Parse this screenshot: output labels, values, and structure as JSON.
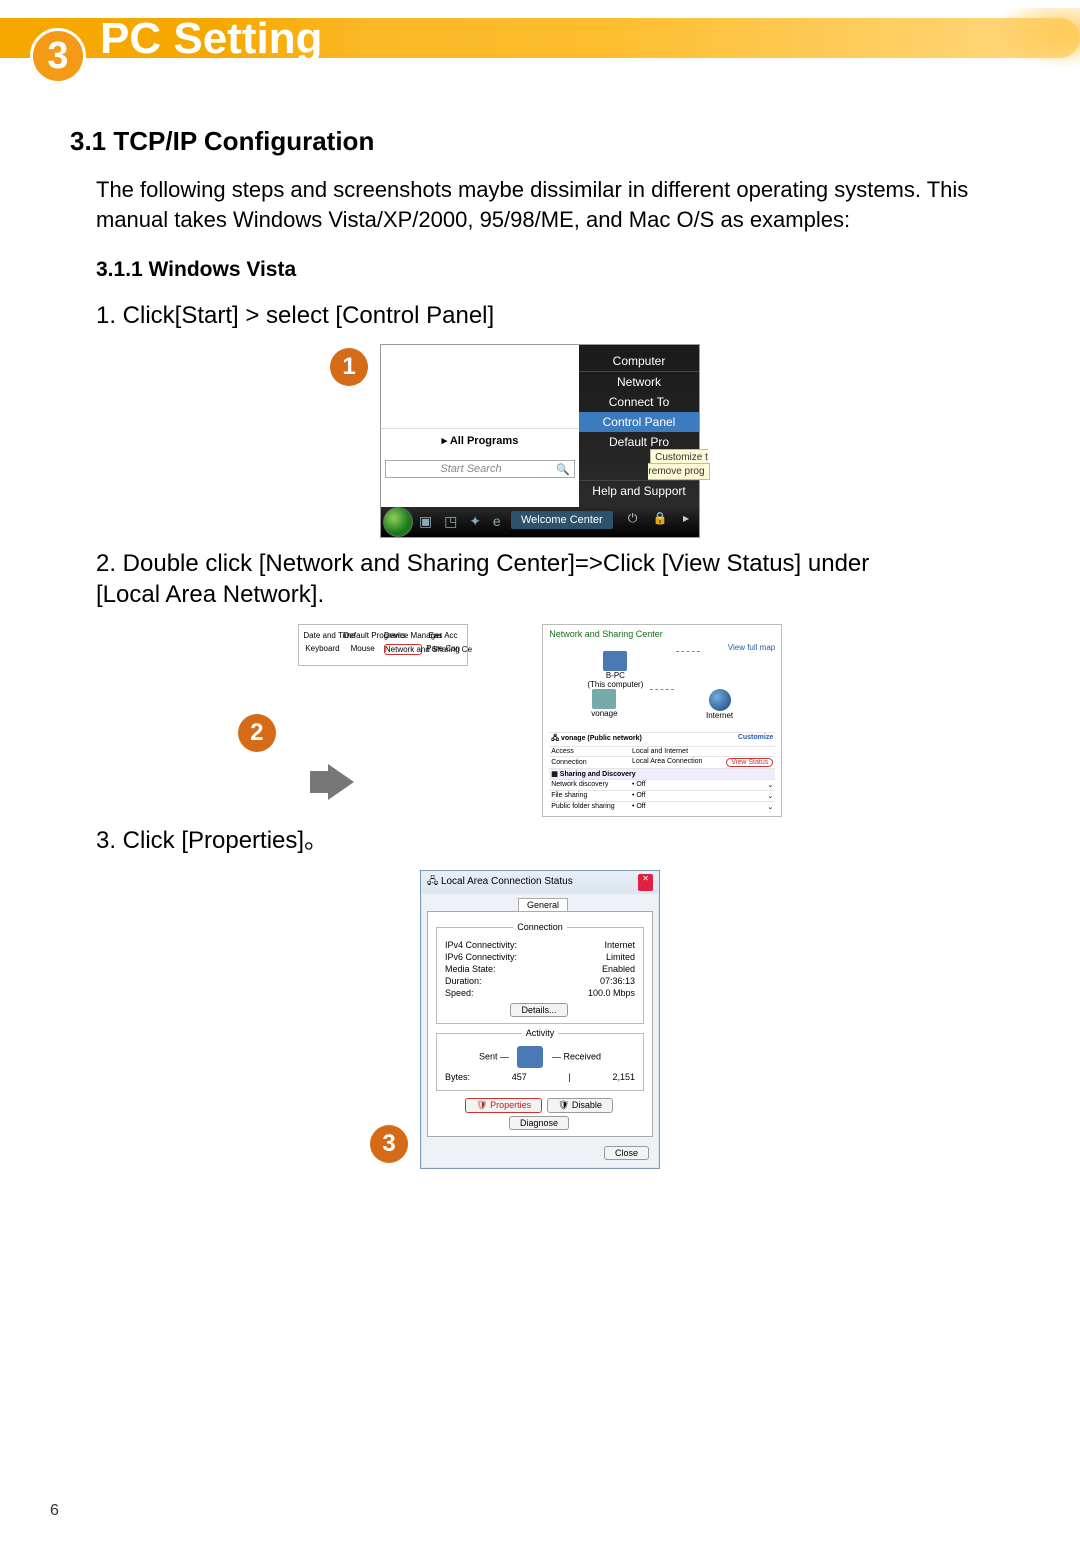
{
  "chapter": {
    "number": "3",
    "title": "PC Setting"
  },
  "section": {
    "heading": "3.1 TCP/IP Configuration"
  },
  "intro": "The following steps and screenshots maybe dissimilar in  different operating systems. This manual takes Windows Vista/XP/2000, 95/98/ME, and Mac O/S as examples:",
  "subsection": {
    "heading": "3.1.1 Windows Vista"
  },
  "steps": {
    "s1": "1. Click[Start] > select [Control Panel]",
    "s2": "2. Double click [Network and Sharing Center]=>Click [View Status] under [Local Area Network].",
    "s3": "3. Click [Properties]。"
  },
  "badges": {
    "b1": "1",
    "b2": "2",
    "b3": "3"
  },
  "fig1": {
    "right_menu": {
      "computer": "Computer",
      "network": "Network",
      "connect": "Connect To",
      "control_panel": "Control Panel",
      "default": "Default Pro",
      "tooltip1": "Customize t",
      "tooltip2": "remove prog",
      "help": "Help and Support"
    },
    "all_programs": "All Programs",
    "search_placeholder": "Start Search",
    "taskbar_tab": "Welcome Center",
    "tray_icons": "⏻  🔒  ▸"
  },
  "fig2": {
    "ctrl_icons": {
      "r1c1": "Date and Time",
      "r1c2": "Default Programs",
      "r1c3": "Device Manager",
      "r1c4": "Eas Acc",
      "r2c1": "Keyboard",
      "r2c2": "Mouse",
      "r2c3": "Network and Sharing Ce",
      "r2c4": "Pare Con"
    },
    "ns_title": "Network and Sharing Center",
    "view_full_map": "View full map",
    "pc_label": "B-PC",
    "pc_sub": "(This computer)",
    "mid_label": "vonage",
    "net_label": "Internet",
    "customize": "Customize",
    "row_net": "vonage (Public network)",
    "row_access_l": "Access",
    "row_access_r": "Local and Internet",
    "row_conn_l": "Connection",
    "row_conn_r": "Local Area Connection",
    "view_status": "View Status",
    "sd_header": "Sharing and Discovery",
    "sd1_l": "Network discovery",
    "sd1_r": "• Off",
    "sd2_l": "File sharing",
    "sd2_r": "• Off",
    "sd3_l": "Public folder sharing",
    "sd3_r": "• Off"
  },
  "fig3": {
    "title": "Local Area Connection Status",
    "tab": "General",
    "grp_conn": "Connection",
    "ipv4_l": "IPv4 Connectivity:",
    "ipv4_r": "Internet",
    "ipv6_l": "IPv6 Connectivity:",
    "ipv6_r": "Limited",
    "media_l": "Media State:",
    "media_r": "Enabled",
    "dur_l": "Duration:",
    "dur_r": "07:36:13",
    "speed_l": "Speed:",
    "speed_r": "100.0 Mbps",
    "details_btn": "Details...",
    "grp_act": "Activity",
    "sent": "Sent",
    "received": "Received",
    "bytes_l": "Bytes:",
    "bytes_sent": "457",
    "bytes_recv": "2,151",
    "btn_props": "Properties",
    "btn_disable": "Disable",
    "btn_diag": "Diagnose",
    "btn_close": "Close"
  },
  "page_number": "6"
}
